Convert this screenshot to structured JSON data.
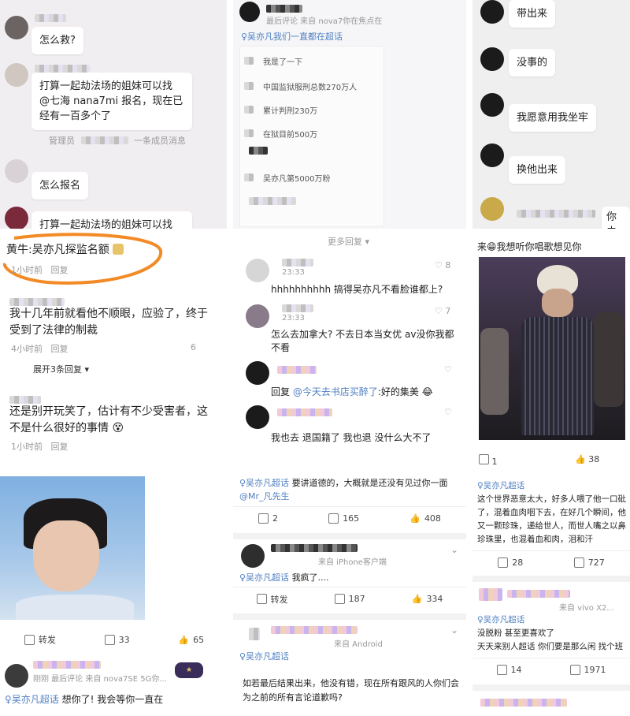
{
  "p1": {
    "msg1": "怎么救?",
    "msg2": "打算一起劫法场的姐妹可以找 @七海 nana7mi 报名，现在已经有一百多个了",
    "meta2a": "管理员",
    "meta2b": "一条成员消息",
    "msg3": "怎么报名",
    "msg4": "打算一起劫法场的姐妹可以找"
  },
  "p2": {
    "top_meta": "最后评论  来自 nova7你在焦点在",
    "topic": "♀吴亦凡我们一直都在超话",
    "rows": [
      "我是了一下",
      "中国监狱服刑总数270万人",
      "累计判刑230万",
      "在狱目前500万",
      "吴亦凡第5000万粉"
    ]
  },
  "p3": {
    "msgs": [
      "带出来",
      "没事的",
      "我愿意用我坐牢",
      "换他出来"
    ],
    "tail": "你去"
  },
  "p4": {
    "c1_name": "黄牛:",
    "c1_text": "吴亦凡探监名额",
    "c1_time": "1小时前",
    "c1_reply": "回复",
    "c2_text": "我十几年前就看他不顺眼，应验了，终于受到了法律的制裁",
    "c2_time": "4小时前",
    "c2_reply": "回复",
    "c2_like": "6",
    "expand": "展开3条回复",
    "c3_text": "还是别开玩笑了，估计有不少受害者，这不是什么很好的事情",
    "c3_time": "1小时前",
    "c3_reply": "回复"
  },
  "p5": {
    "more": "更多回复",
    "c1_time": "23:33",
    "c1_like": "8",
    "c1_text": "hhhhhhhhhh 搞得吴亦凡不看脸谁都上?",
    "c2_time": "23:33",
    "c2_like": "7",
    "c2_text": "怎么去加拿大? 不去日本当女优 av没你我都不看",
    "c3_reply_prefix": "回复",
    "c3_at": "@今天去书店买醉了",
    "c3_text": ":好的集美",
    "c4_text": "我也去  退国籍了  我也退  没什么大不了"
  },
  "p6": {
    "top": "来",
    "top_text": "我想听你唱歌想见你"
  },
  "p7": {
    "repost": "转发",
    "comment": "33",
    "like": "65",
    "meta": "刚刚  最后评论  来自 nova7SE 5G你...",
    "topic": "♀吴亦凡超话",
    "text": "想你了! 我会等你一直在"
  },
  "p8": {
    "topic": "♀吴亦凡超话",
    "text": "要讲道德的，大概就是还没有见过你一面",
    "mention": "@Mr_凡先生",
    "repost": "2",
    "comment": "165",
    "like": "408",
    "meta2": "来自 iPhone客户端",
    "topic2": "♀吴亦凡超话",
    "text2": "我疯了....",
    "repost2": "转发",
    "comment2": "187",
    "like2": "334",
    "meta3": "来自 Android",
    "topic3": "♀吴亦凡超话",
    "text3": "如若最后结果出来，他没有错，现在所有跟风的人你们会为之前的所有言论道歉吗?"
  },
  "p9": {
    "repost": "1",
    "like": "38",
    "topic": "♀吴亦凡超话",
    "text": "这个世界恶意太大，好多人喂了他一口砒了，混着血肉咽下去，在好几个瞬间，他又一颗珍珠，递给世人，而世人嘴之以鼻珍珠里，也混着血和肉，泪和汗",
    "comment": "28",
    "like2": "727",
    "meta2": "来自 vivo X2...",
    "topic2": "♀吴亦凡超话",
    "text2a": "没脱粉  甚至更喜欢了",
    "text2b": "天天来别人超话  你们要是那么闲  找个班",
    "comment2": "14",
    "like3": "1971"
  }
}
